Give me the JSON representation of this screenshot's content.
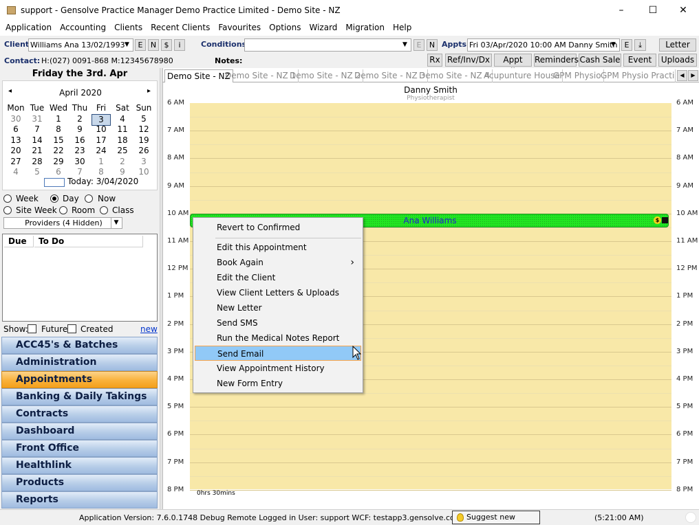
{
  "window": {
    "title": "support - Gensolve Practice Manager",
    "site_title": "Demo Practice Limited  -  Demo Site - NZ",
    "minimize": "–",
    "maximize": "☐",
    "close": "✕"
  },
  "menu": [
    "Application",
    "Accounting",
    "Clients",
    "Recent Clients",
    "Favourites",
    "Options",
    "Wizard",
    "Migration",
    "Help"
  ],
  "client_bar": {
    "client_label": "Client",
    "client_value": "Williams Ana 13/02/1993",
    "btn_e": "E",
    "btn_n": "N",
    "btn_s": "$",
    "btn_i": "i",
    "conditions_label": "Conditions",
    "conditions_value": "",
    "cond_e": "E",
    "cond_n": "N",
    "appts_label": "Appts",
    "appts_value": "Fri 03/Apr/2020  10:00 AM Danny Smith",
    "appts_e": "E",
    "appts_down": "⤓",
    "letter_button": "Letter",
    "contact_label": "Contact:",
    "contact_value": "H:(027) 0091-868  M:12345678980",
    "notes_label": "Notes:"
  },
  "toolbar": [
    "Rx",
    "Ref/Inv/Dx",
    "Appt Slip",
    "Reminders",
    "Cash Sale",
    "Event",
    "Uploads"
  ],
  "left": {
    "date_heading": "Friday the 3rd. Apr",
    "month": "April 2020",
    "prev": "◂",
    "next": "▸",
    "weekdays": [
      "Mon",
      "Tue",
      "Wed",
      "Thu",
      "Fri",
      "Sat",
      "Sun"
    ],
    "weeks": [
      [
        "30",
        "31",
        "1",
        "2",
        "3",
        "4",
        "5"
      ],
      [
        "6",
        "7",
        "8",
        "9",
        "10",
        "11",
        "12"
      ],
      [
        "13",
        "14",
        "15",
        "16",
        "17",
        "18",
        "19"
      ],
      [
        "20",
        "21",
        "22",
        "23",
        "24",
        "25",
        "26"
      ],
      [
        "27",
        "28",
        "29",
        "30",
        "1",
        "2",
        "3"
      ],
      [
        "4",
        "5",
        "6",
        "7",
        "8",
        "9",
        "10"
      ]
    ],
    "today_label": "Today: 3/04/2020",
    "view_options": [
      "Week",
      "Day",
      "Now",
      "Site Week",
      "Room",
      "Class"
    ],
    "selected_view": "Day",
    "providers": "Providers (4 Hidden)",
    "todo_headers": [
      "Due",
      "To Do"
    ],
    "show_label": "Show:",
    "future_label": "Future",
    "created_label": "Created",
    "new_link": "new",
    "nav": [
      "ACC45's & Batches",
      "Administration",
      "Appointments",
      "Banking & Daily Takings",
      "Contracts",
      "Dashboard",
      "Front Office",
      "Healthlink",
      "Products",
      "Reports"
    ],
    "active_nav": "Appointments"
  },
  "tabs": [
    "Demo Site - NZ",
    "Demo Site - NZ 1",
    "Demo Site - NZ 2",
    "Demo Site - NZ 3",
    "Demo Site - NZ 4",
    "Acupunture House",
    "GPM Physio",
    "GPM Physio Practice"
  ],
  "schedule": {
    "provider_name": "Danny Smith",
    "provider_role": "Physiotherapist",
    "hours": [
      "6 AM",
      "7 AM",
      "8 AM",
      "9 AM",
      "10 AM",
      "11 AM",
      "12 PM",
      "1 PM",
      "2 PM",
      "3 PM",
      "4 PM",
      "5 PM",
      "6 PM",
      "7 PM",
      "8 PM"
    ],
    "appointment_client": "Ana Williams",
    "appointment_badge": "$",
    "footer_total": "0hrs 30mins"
  },
  "context_menu": [
    {
      "label": "Revert to Confirmed"
    },
    {
      "label": "Edit this Appointment"
    },
    {
      "label": "Book Again",
      "submenu": "›"
    },
    {
      "label": "Edit the Client"
    },
    {
      "label": "View Client Letters & Uploads"
    },
    {
      "label": "New Letter"
    },
    {
      "label": "Send SMS"
    },
    {
      "label": "Run the Medical Notes Report"
    },
    {
      "label": "Send Email"
    },
    {
      "label": "View Appointment History"
    },
    {
      "label": "New Form Entry"
    }
  ],
  "highlighted_item": "Send Email",
  "status": {
    "version_text": "Application Version: 7.6.0.1748 Debug Remote  Logged in User: support WCF: testapp3.gensolve.com:4551",
    "suggest_button": "Suggest new feature",
    "time": "(5:21:00 AM)"
  },
  "colors": {
    "appointment_fill": "#22e622",
    "schedule_bg": "#f8e8a8",
    "highlight": "#91c9f7",
    "highlight_border": "#f8a44a",
    "nav_active": "#f9b13a"
  }
}
